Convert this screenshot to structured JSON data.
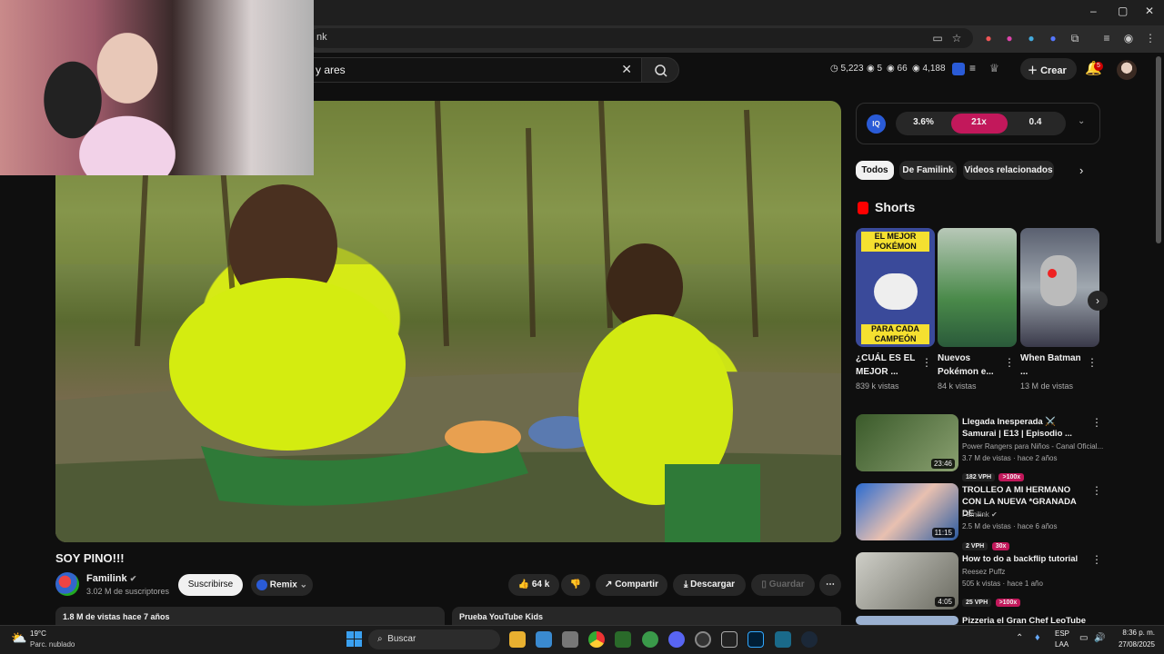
{
  "browser": {
    "url_fragment": "nk",
    "window_controls": [
      "–",
      "▢",
      "✕"
    ]
  },
  "header": {
    "search_query": "y ares",
    "stats": {
      "views": "5,223",
      "v2": "5",
      "v3": "66",
      "v4": "4,188"
    },
    "create_label": "Crear",
    "notif_count": "5"
  },
  "video": {
    "title": "SOY PINO!!!",
    "channel": "Familink",
    "subscribers": "3.02 M de suscriptores",
    "subscribe_label": "Suscribirse",
    "remix_label": "Remix",
    "likes": "64 k",
    "share_label": "Compartir",
    "download_label": "Descargar",
    "save_label": "Guardar",
    "views_and_date": "1.8 M de vistas  hace 7 años",
    "kids_promo": "Prueba YouTube Kids"
  },
  "iq": {
    "badge": "IQ",
    "val1": "3.6%",
    "val2": "21x",
    "val3": "0.4"
  },
  "chips": [
    "Todos",
    "De Familink",
    "Videos relacionados"
  ],
  "shorts": {
    "title": "Shorts",
    "items": [
      {
        "title": "¿CUÁL ES EL MEJOR ...",
        "views": "839 k vistas",
        "overlay_top": "EL MEJOR POKÉMON",
        "overlay_bottom": "PARA CADA CAMPEÓN",
        "color": "#3a4a9a"
      },
      {
        "title": "Nuevos Pokémon e...",
        "views": "84 k vistas",
        "color": "#6a9a6a"
      },
      {
        "title": "When Batman ...",
        "views": "13 M de vistas",
        "color": "#6a7080"
      }
    ]
  },
  "related": [
    {
      "title": "Llegada Inesperada ⚔️ Samurai | E13 | Episodio ...",
      "channel": "Power Rangers para Niños - Canal Oficial...",
      "meta": "3.7 M de vistas · hace 2 años",
      "duration": "23:46",
      "vph": "182 VPH",
      "x": ">100x",
      "color": "#4a6a3a"
    },
    {
      "title": "TROLLEO A MI HERMANO CON LA NUEVA *GRANADA DE ...",
      "channel": "Familink",
      "meta": "2.5 M de vistas · hace 6 años",
      "duration": "11:15",
      "vph": "2 VPH",
      "x": "30x",
      "color": "#3a7ad0"
    },
    {
      "title": "How to do a backflip tutorial",
      "channel": "Reesez Puffz",
      "meta": "505 k vistas · hace 1 año",
      "duration": "4:05",
      "vph": "25 VPH",
      "x": ">100x",
      "color": "#8a8a80"
    },
    {
      "title": "Pizzeria el Gran Chef LeoTube",
      "channel": "",
      "meta": "",
      "duration": "",
      "vph": "",
      "x": "",
      "color": "#9ab0d0"
    }
  ],
  "taskbar": {
    "weather_temp": "19°C",
    "weather_desc": "Parc. nublado",
    "search_placeholder": "Buscar",
    "lang": "ESP",
    "lang2": "LAA",
    "time": "8:36 p. m.",
    "date": "27/08/2025"
  }
}
